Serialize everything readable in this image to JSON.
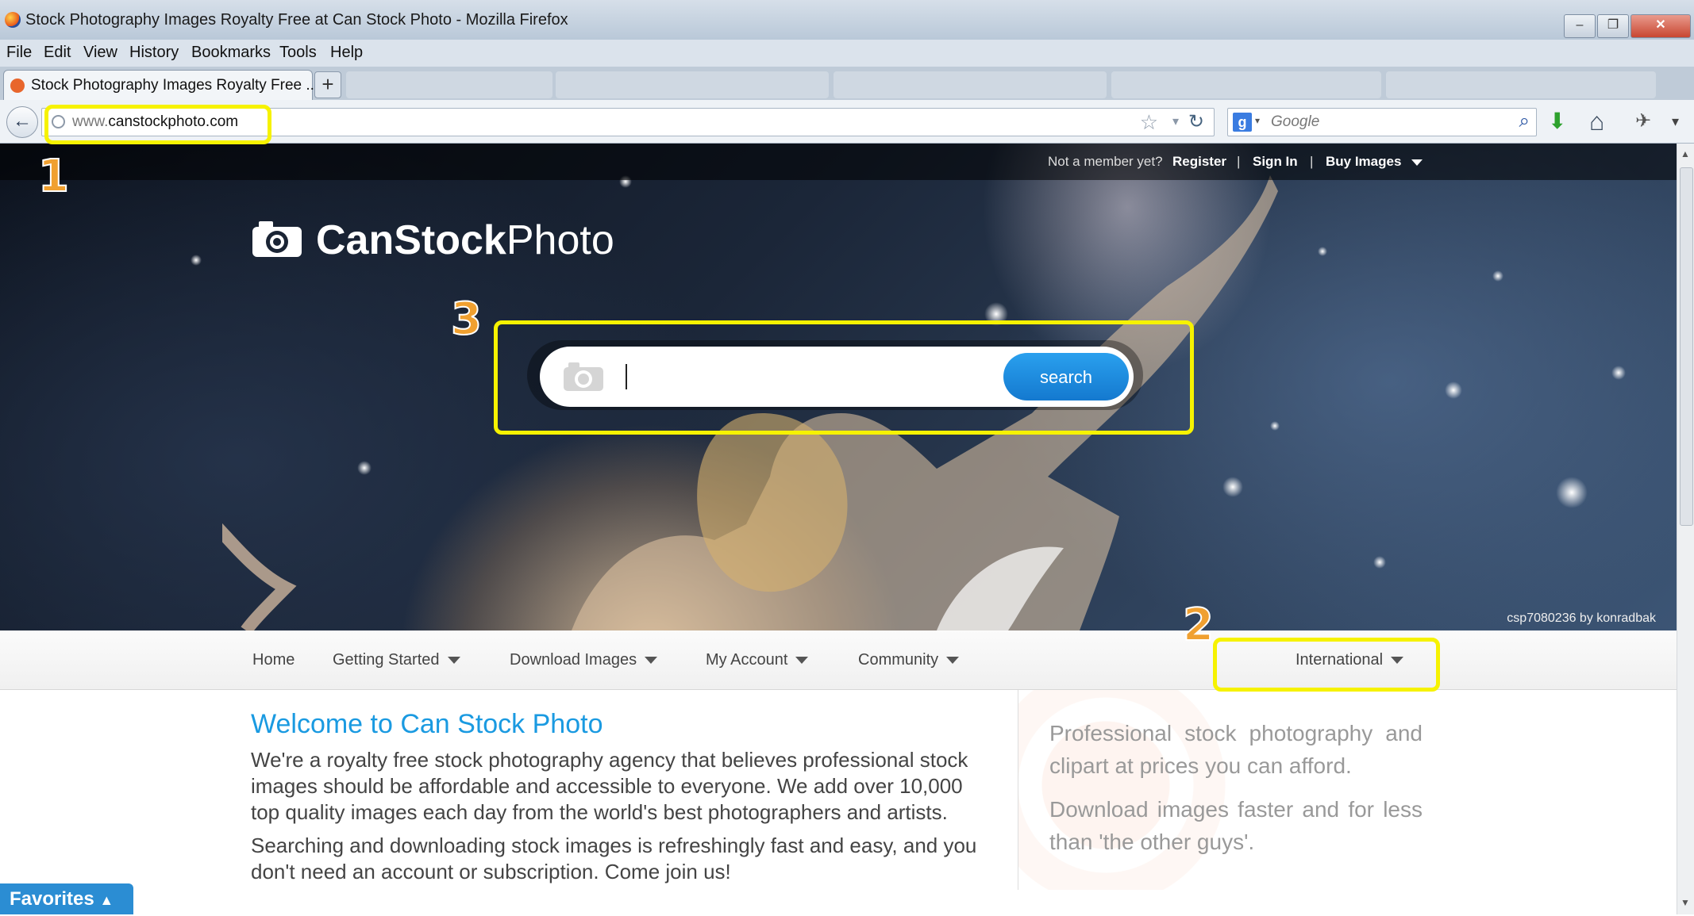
{
  "window": {
    "title": "Stock Photography Images Royalty Free at Can Stock Photo - Mozilla Firefox",
    "minimize": "–",
    "restore": "❐",
    "close": "✕"
  },
  "menu": [
    "File",
    "Edit",
    "View",
    "History",
    "Bookmarks",
    "Tools",
    "Help"
  ],
  "tabs": {
    "active_label": "Stock Photography Images Royalty Free ...",
    "new_tab": "+"
  },
  "navbar": {
    "back": "←",
    "url_host": "www.",
    "url_domain": "canstockphoto.com",
    "search_engine": "g",
    "search_placeholder": "Google",
    "star": "☆",
    "dropdown": "▾",
    "reload": "↻",
    "magnifier": "⌕",
    "download": "⬇",
    "home": "⌂",
    "addons": "✈",
    "menu": "▾"
  },
  "site": {
    "top_nav": {
      "prompt": "Not a member yet?",
      "register": "Register",
      "sep": "|",
      "sign_in": "Sign In",
      "buy_images": "Buy Images"
    },
    "logo_bold": "CanStock",
    "logo_light": "Photo",
    "search_button": "search",
    "photo_credit": "csp7080236 by konradbak",
    "main_nav": [
      "Home",
      "Getting Started",
      "Download Images",
      "My Account",
      "Community"
    ],
    "international": "International",
    "welcome_title": "Welcome to Can Stock Photo",
    "para1": "We're a royalty free stock photography agency that believes professional stock images should be affordable and accessible to everyone. We add over 10,000 top quality images each day from the world's best photographers and artists.",
    "para2": "Searching and downloading stock images is refreshingly fast and easy, and you don't need an account or subscription. Come join us!",
    "side1": "Professional stock photography and clipart at prices you can afford.",
    "side2": "Download images faster and for less than 'the other guys'.",
    "favorites": "Favorites"
  },
  "annotations": {
    "n1": "1",
    "n2": "2",
    "n3": "3",
    "color": "#f6f200"
  }
}
